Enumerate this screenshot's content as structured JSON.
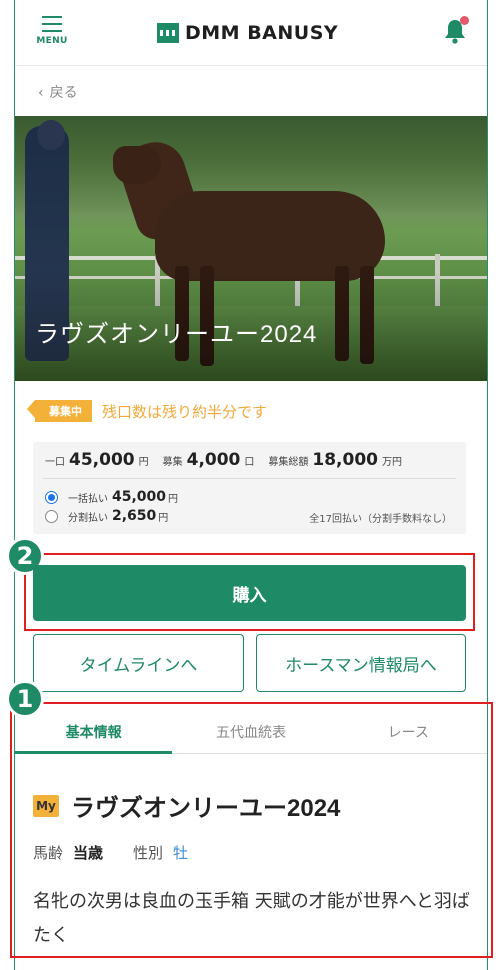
{
  "header": {
    "menu_label": "MENU",
    "logo_text": "DMM BANUSY",
    "notification_dot": true
  },
  "nav": {
    "back_label": "戻る"
  },
  "hero": {
    "title": "ラヴズオンリーユー2024"
  },
  "status": {
    "badge": "募集中",
    "message": "残口数は残り約半分です"
  },
  "pricing": {
    "unit_label": "一口",
    "unit_price": "45,000",
    "unit_price_suffix": "円",
    "shares_label": "募集",
    "shares": "4,000",
    "shares_suffix": "口",
    "total_label": "募集総額",
    "total": "18,000",
    "total_suffix": "万円",
    "lump_label": "一括払い",
    "lump_value": "45,000",
    "lump_suffix": "円",
    "lump_selected": true,
    "split_label": "分割払い",
    "split_value": "2,650",
    "split_suffix": "円",
    "installments_note": "全17回払い（分割手数料なし）"
  },
  "actions": {
    "buy_label": "購入",
    "timeline_label": "タイムラインへ",
    "horseman_label": "ホースマン情報局へ"
  },
  "annotations": {
    "marker_1": "1",
    "marker_2": "2"
  },
  "tabs": [
    {
      "label": "基本情報",
      "active": true
    },
    {
      "label": "五代血統表",
      "active": false
    },
    {
      "label": "レース",
      "active": false
    }
  ],
  "info": {
    "my_badge": "My",
    "name": "ラヴズオンリーユー2024",
    "age_label": "馬齢",
    "age_value": "当歳",
    "sex_label": "性別",
    "sex_value": "牡",
    "description": "名牝の次男は良血の玉手箱 天賦の才能が世界へと羽ばたく"
  },
  "colors": {
    "brand_green": "#1f8a66",
    "badge_orange": "#f4b13a",
    "annotation_red": "#e02020",
    "link_blue": "#3c8dd6"
  }
}
